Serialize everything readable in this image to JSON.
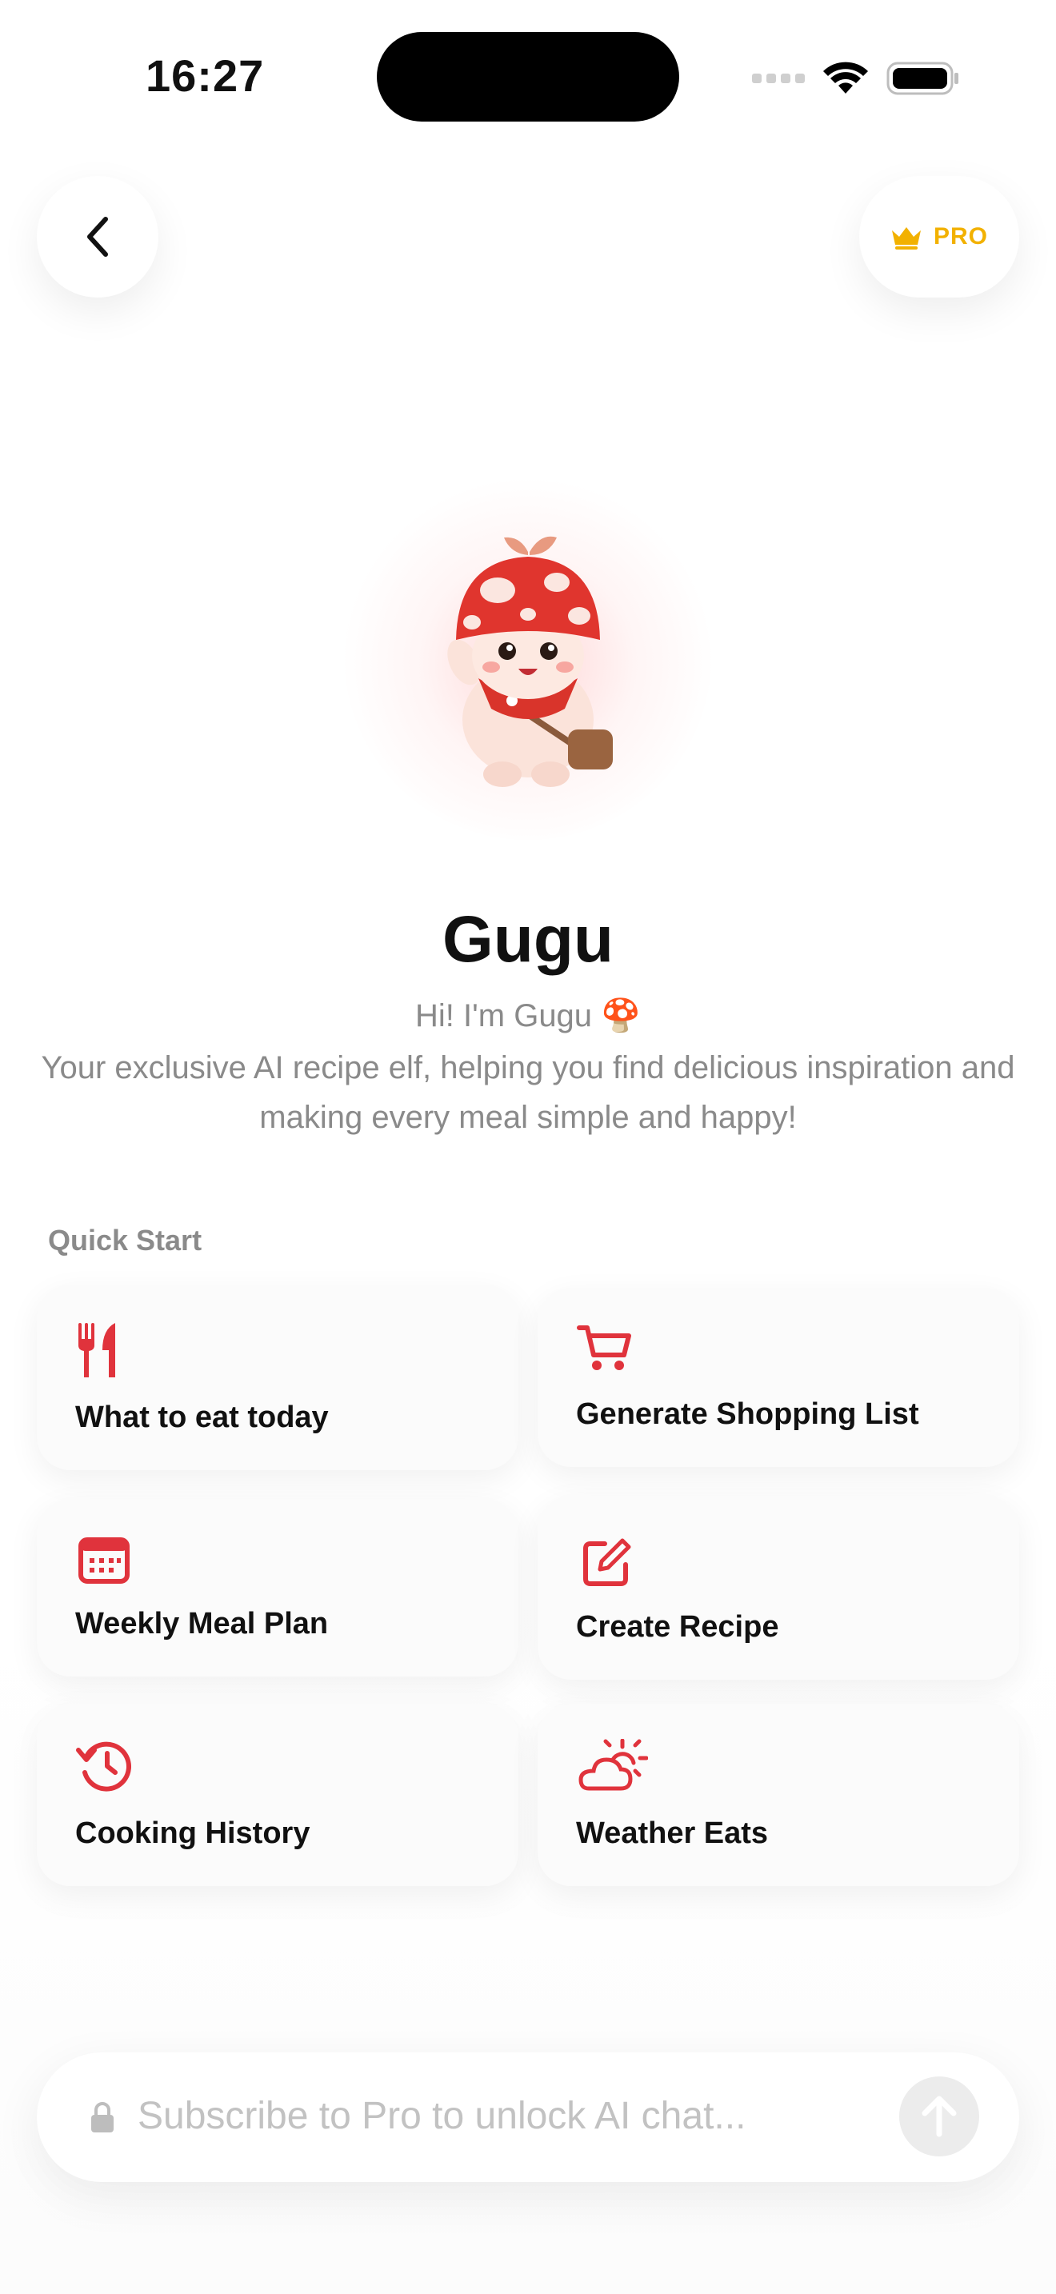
{
  "status_bar": {
    "time": "16:27"
  },
  "header": {
    "pro_label": "PRO"
  },
  "profile": {
    "name": "Gugu",
    "greeting": "Hi! I'm Gugu 🍄",
    "description": "Your exclusive AI recipe elf, helping you find delicious inspiration and making every meal simple and happy!"
  },
  "quick_start": {
    "title": "Quick Start",
    "items": [
      {
        "label": "What to eat today",
        "icon": "fork-knife-icon"
      },
      {
        "label": "Generate Shopping List",
        "icon": "cart-icon"
      },
      {
        "label": "Weekly Meal Plan",
        "icon": "calendar-icon"
      },
      {
        "label": "Create Recipe",
        "icon": "edit-icon"
      },
      {
        "label": "Cooking History",
        "icon": "history-icon"
      },
      {
        "label": "Weather Eats",
        "icon": "sun-cloud-icon"
      }
    ]
  },
  "chat": {
    "placeholder": "Subscribe to Pro to unlock AI chat..."
  },
  "colors": {
    "accent": "#e0333c",
    "pro": "#f2b100",
    "muted": "#8a8a8a"
  }
}
